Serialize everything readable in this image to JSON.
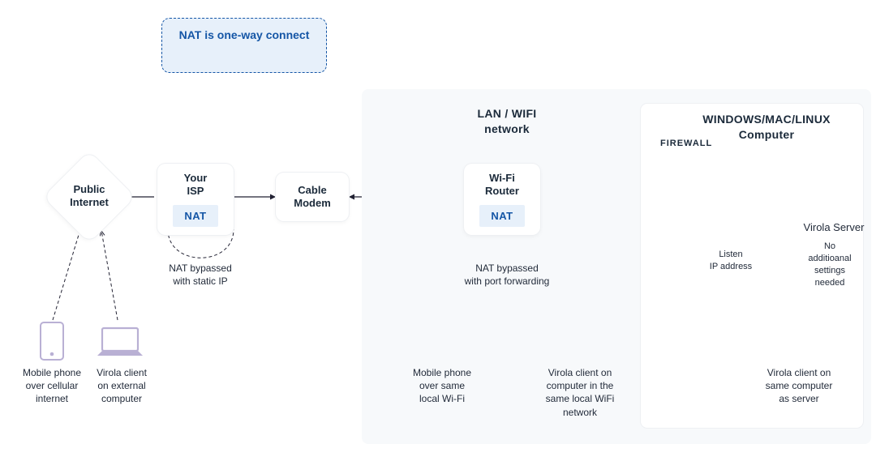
{
  "info_box": {
    "title": "NAT is one-way connect"
  },
  "nodes": {
    "public_internet": "Public\nInternet",
    "your_isp": "Your\nISP",
    "nat1": "NAT",
    "cable_modem": "Cable\nModem",
    "wifi_router": "Wi-Fi\nRouter",
    "nat2": "NAT",
    "virola_server": "Virola Server"
  },
  "regions": {
    "lan_wifi": "LAN / WIFI\nnetwork",
    "computer": "WINDOWS/MAC/LINUX\nComputer",
    "firewall": "FIREWALL"
  },
  "captions": {
    "nat_bypass_static": "NAT bypassed\nwith static IP",
    "nat_bypass_port": "NAT bypassed\nwith port forwarding",
    "listen_ip": "Listen\nIP address",
    "no_settings": "No\nadditioanal\nsettings\nneeded",
    "mobile_cellular": "Mobile phone\nover cellular\ninternet",
    "client_external": "Virola client\non external\ncomputer",
    "mobile_same_wifi": "Mobile phone\nover same\nlocal Wi-Fi",
    "client_same_lan": "Virola client on\ncomputer in the\nsame local WiFi\nnetwork",
    "client_same_computer": "Virola client on\nsame computer\nas server"
  }
}
